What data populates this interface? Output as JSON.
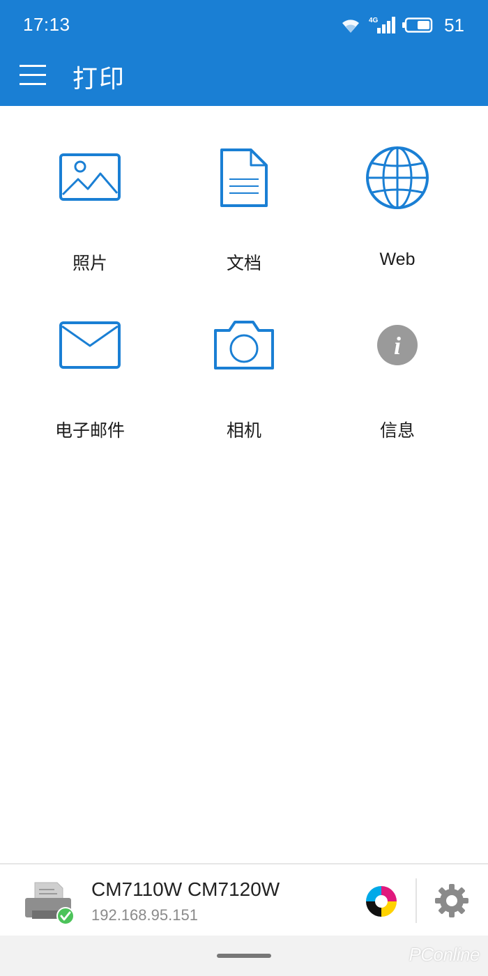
{
  "status_bar": {
    "time": "17:13",
    "network_label": "4G",
    "battery_level": "51"
  },
  "app_bar": {
    "title": "打印",
    "menu_icon": "hamburger-menu-icon"
  },
  "colors": {
    "primary": "#1a7fd4",
    "icon_blue": "#1a7fd4",
    "info_gray": "#9a9a9a",
    "status_ok_green": "#4cc35a"
  },
  "tiles": [
    {
      "label": "照片",
      "icon": "photo-icon"
    },
    {
      "label": "文档",
      "icon": "document-icon"
    },
    {
      "label": "Web",
      "icon": "globe-icon"
    },
    {
      "label": "电子邮件",
      "icon": "email-icon"
    },
    {
      "label": "相机",
      "icon": "camera-icon"
    },
    {
      "label": "信息",
      "icon": "info-icon"
    }
  ],
  "printer": {
    "name": "CM7110W CM7120W",
    "ip": "192.168.95.151",
    "status": "connected"
  },
  "watermark": "PConline"
}
